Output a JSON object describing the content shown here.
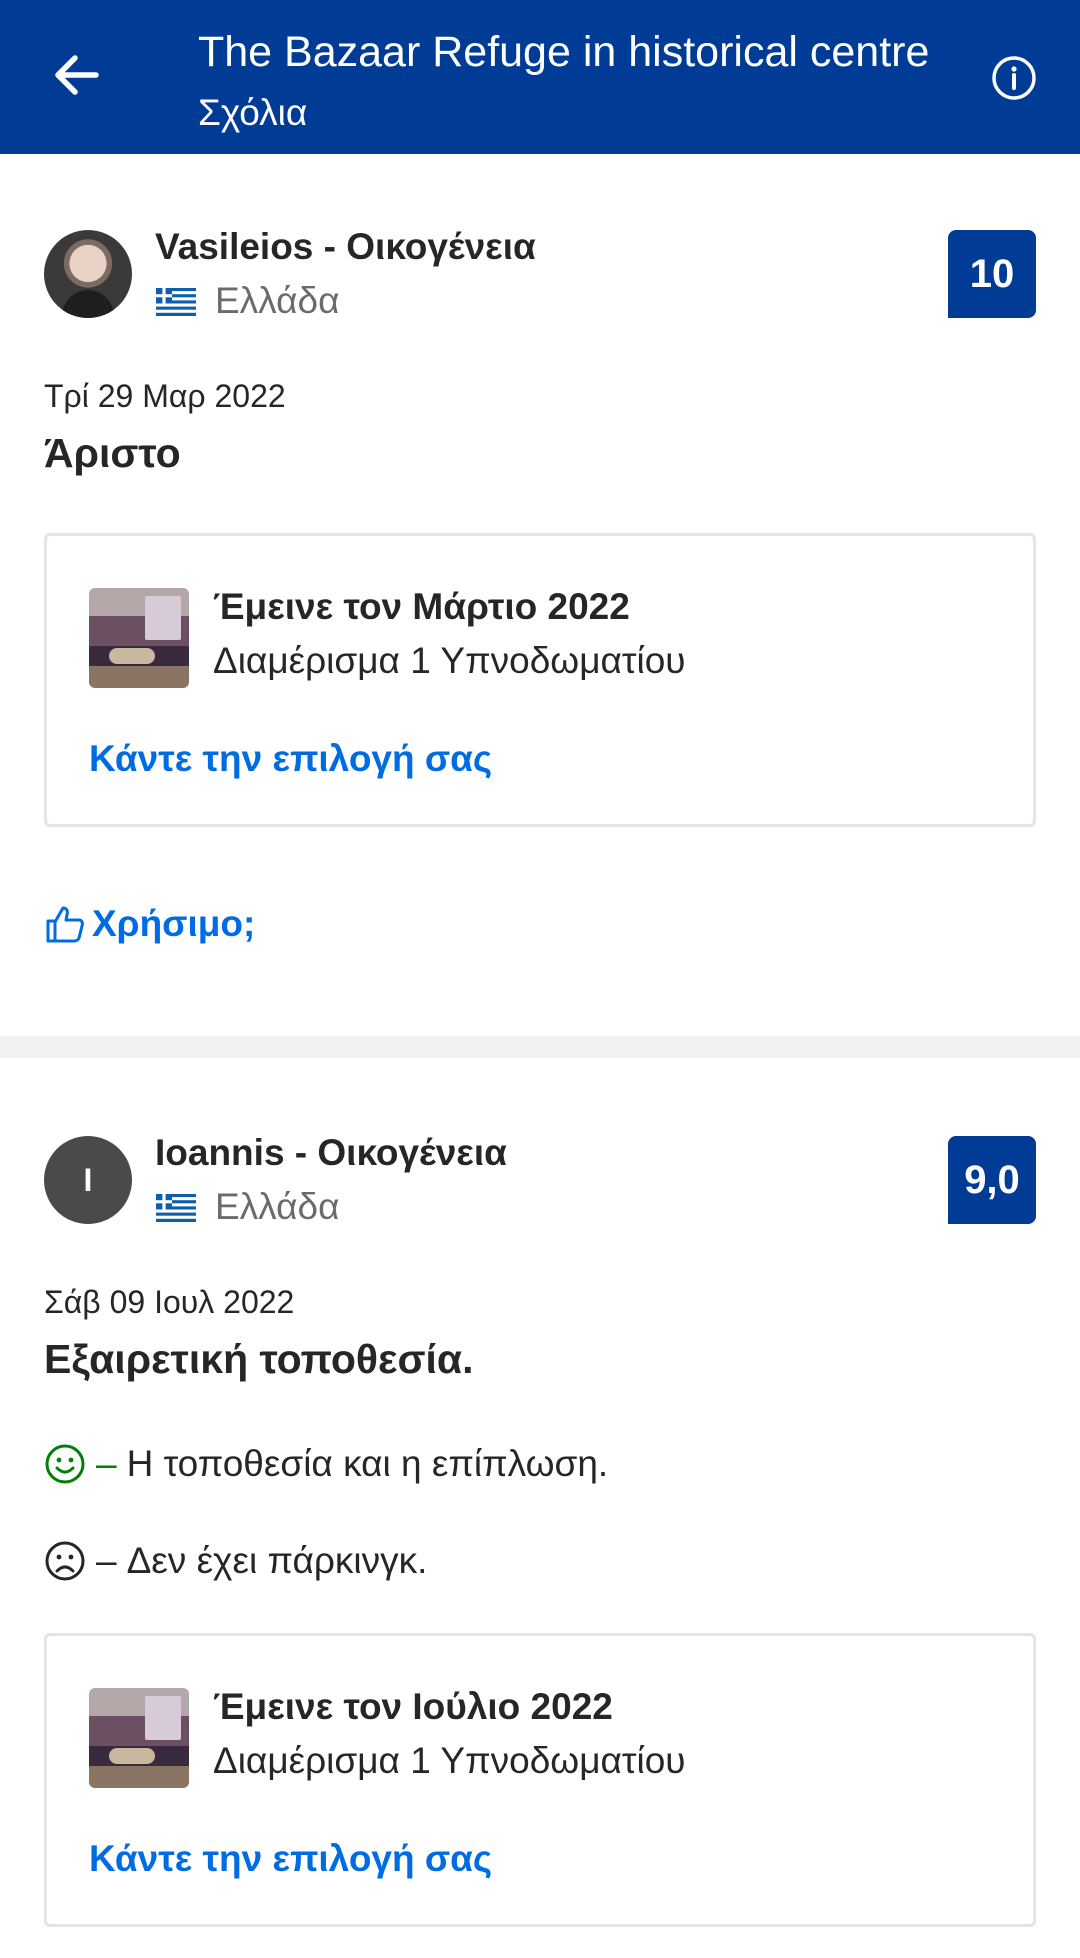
{
  "header": {
    "title": "The Bazaar Refuge in historical centre",
    "subtitle": "Σχόλια",
    "back_icon": "arrow-left-icon",
    "info_icon": "info-icon"
  },
  "colors": {
    "brand": "#003b95",
    "link": "#006ce4",
    "positive": "#008009"
  },
  "reviews": [
    {
      "name": "Vasileios - Οικογένεια",
      "country": "Ελλάδα",
      "score": "10",
      "date": "Τρί 29 Μαρ 2022",
      "headline": "Άριστο",
      "stay": {
        "title": "Έμεινε τον Μάρτιο 2022",
        "room": "Διαμέρισμα 1 Υπνοδωματίου",
        "link": "Κάντε την επιλογή σας"
      },
      "helpful": "Χρήσιμο;"
    },
    {
      "name": "Ioannis - Οικογένεια",
      "avatar_letter": "I",
      "country": "Ελλάδα",
      "score": "9,0",
      "date": "Σάβ 09 Ιουλ 2022",
      "headline": "Εξαιρετική τοποθεσία.",
      "positive": "Η τοποθεσία και η επίπλωση.",
      "negative": "Δεν έχει πάρκινγκ.",
      "dash": "–",
      "stay": {
        "title": "Έμεινε τον Ιούλιο 2022",
        "room": "Διαμέρισμα 1 Υπνοδωματίου",
        "link": "Κάντε την επιλογή σας"
      }
    }
  ]
}
